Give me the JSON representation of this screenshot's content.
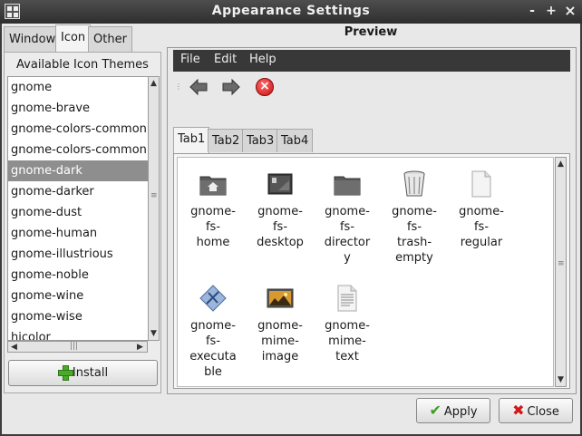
{
  "window": {
    "title": "Appearance Settings",
    "controls": [
      "-",
      "+",
      "×"
    ]
  },
  "tabs": [
    {
      "label": "Window"
    },
    {
      "label": "Icon",
      "active": true
    },
    {
      "label": "Other"
    }
  ],
  "theme_panel": {
    "title": "Available Icon Themes",
    "themes": [
      "gnome",
      "gnome-brave",
      "gnome-colors-common",
      "gnome-colors-common",
      "gnome-dark",
      "gnome-darker",
      "gnome-dust",
      "gnome-human",
      "gnome-illustrious",
      "gnome-noble",
      "gnome-wine",
      "gnome-wise",
      "hicolor"
    ],
    "selected": "gnome-dark",
    "install_label": "Install"
  },
  "preview": {
    "title": "Preview",
    "menu": [
      "File",
      "Edit",
      "Help"
    ],
    "tabs": [
      "Tab1",
      "Tab2",
      "Tab3",
      "Tab4"
    ],
    "active_tab": "Tab1",
    "icons": [
      {
        "name": "gnome-home-icon",
        "lines": [
          "gnome-",
          "fs-",
          "home"
        ]
      },
      {
        "name": "gnome-desktop-icon",
        "lines": [
          "gnome-",
          "fs-",
          "desktop"
        ]
      },
      {
        "name": "gnome-directory-icon",
        "lines": [
          "gnome-",
          "fs-",
          "director",
          "y"
        ]
      },
      {
        "name": "gnome-trash-icon",
        "lines": [
          "gnome-",
          "fs-",
          "trash-",
          "empty"
        ]
      },
      {
        "name": "gnome-regular-icon",
        "lines": [
          "gnome-",
          "fs-",
          "regular"
        ]
      },
      {
        "name": "gnome-executable-icon",
        "lines": [
          "gnome-",
          "fs-",
          "executa",
          "ble"
        ]
      },
      {
        "name": "gnome-mime-image-icon",
        "lines": [
          "gnome-",
          "mime-",
          "image"
        ]
      },
      {
        "name": "gnome-mime-text-icon",
        "lines": [
          "gnome-",
          "mime-",
          "text"
        ]
      }
    ]
  },
  "buttons": {
    "apply": "Apply",
    "close": "Close"
  },
  "colors": {
    "titlebar": "#3a3a3a",
    "selection": "#8e8e8e",
    "menubar": "#383838"
  }
}
